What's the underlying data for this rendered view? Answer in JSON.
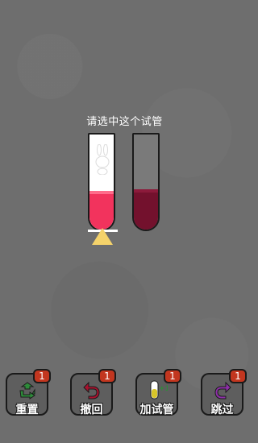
{
  "prompt": "请选中这个试管",
  "tubes": [
    {
      "color": "#f2335d",
      "selected": true
    },
    {
      "color": "#73112d",
      "selected": false
    }
  ],
  "buttons": [
    {
      "label": "重置",
      "count": "1",
      "icon": "reset-icon",
      "color": "#2e8b3a"
    },
    {
      "label": "撤回",
      "count": "1",
      "icon": "undo-icon",
      "color": "#a8122e"
    },
    {
      "label": "加试管",
      "count": "1",
      "icon": "add-tube-icon",
      "color": "#d8c52a"
    },
    {
      "label": "跳过",
      "count": "1",
      "icon": "skip-icon",
      "color": "#8e2fa8"
    }
  ]
}
